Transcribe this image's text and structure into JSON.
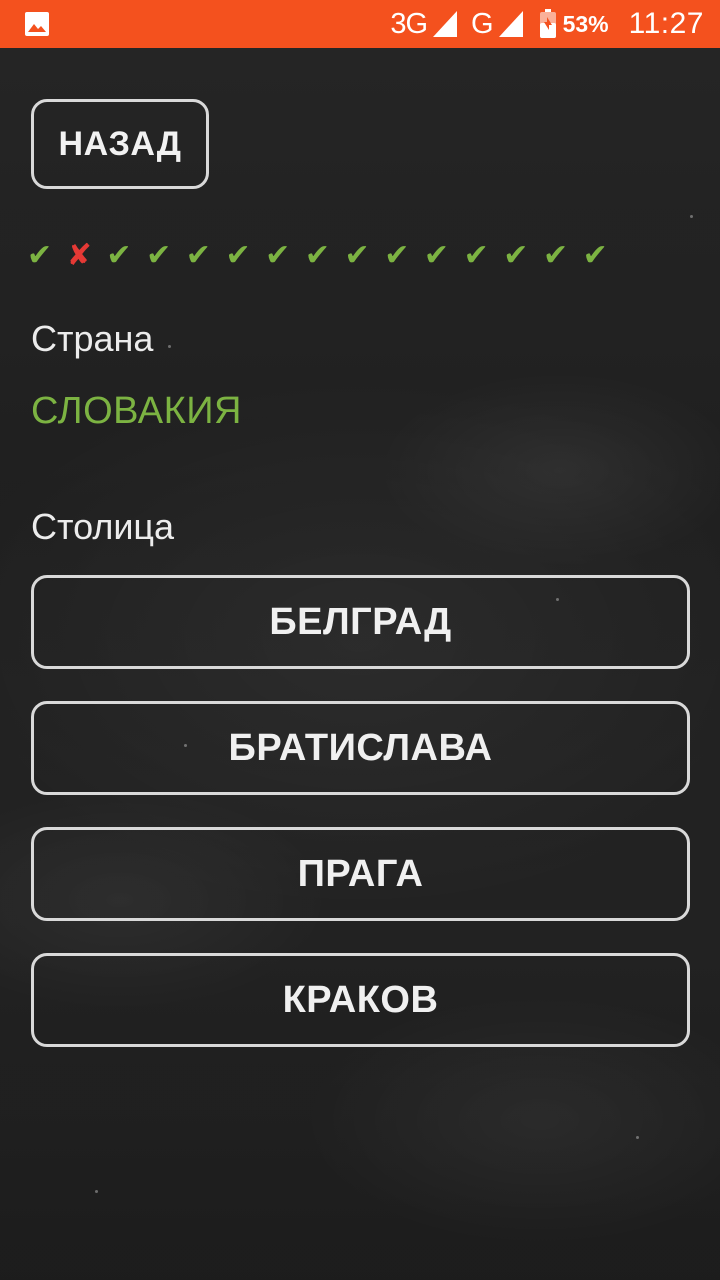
{
  "status_bar": {
    "network_1": "3G",
    "network_2": "G",
    "battery": "53%",
    "time": "11:27",
    "background_color": "#f4511e",
    "icons": [
      "gallery-icon",
      "signal-icon",
      "signal-icon",
      "battery-charging-icon"
    ]
  },
  "back_button": {
    "label": "НАЗАД"
  },
  "progress": {
    "marks": [
      {
        "type": "correct",
        "symbol": "✔"
      },
      {
        "type": "wrong",
        "symbol": "✘"
      },
      {
        "type": "correct",
        "symbol": "✔"
      },
      {
        "type": "correct",
        "symbol": "✔"
      },
      {
        "type": "correct",
        "symbol": "✔"
      },
      {
        "type": "correct",
        "symbol": "✔"
      },
      {
        "type": "correct",
        "symbol": "✔"
      },
      {
        "type": "correct",
        "symbol": "✔"
      },
      {
        "type": "correct",
        "symbol": "✔"
      },
      {
        "type": "correct",
        "symbol": "✔"
      },
      {
        "type": "correct",
        "symbol": "✔"
      },
      {
        "type": "correct",
        "symbol": "✔"
      },
      {
        "type": "correct",
        "symbol": "✔"
      },
      {
        "type": "correct",
        "symbol": "✔"
      },
      {
        "type": "correct",
        "symbol": "✔"
      }
    ],
    "correct_color": "#7cb342",
    "wrong_color": "#e53935"
  },
  "question": {
    "country_label": "Страна",
    "country_value": "СЛОВАКИЯ",
    "capital_label": "Столица"
  },
  "answers": [
    {
      "label": "БЕЛГРАД"
    },
    {
      "label": "БРАТИСЛАВА"
    },
    {
      "label": "ПРАГА"
    },
    {
      "label": "КРАКОВ"
    }
  ]
}
